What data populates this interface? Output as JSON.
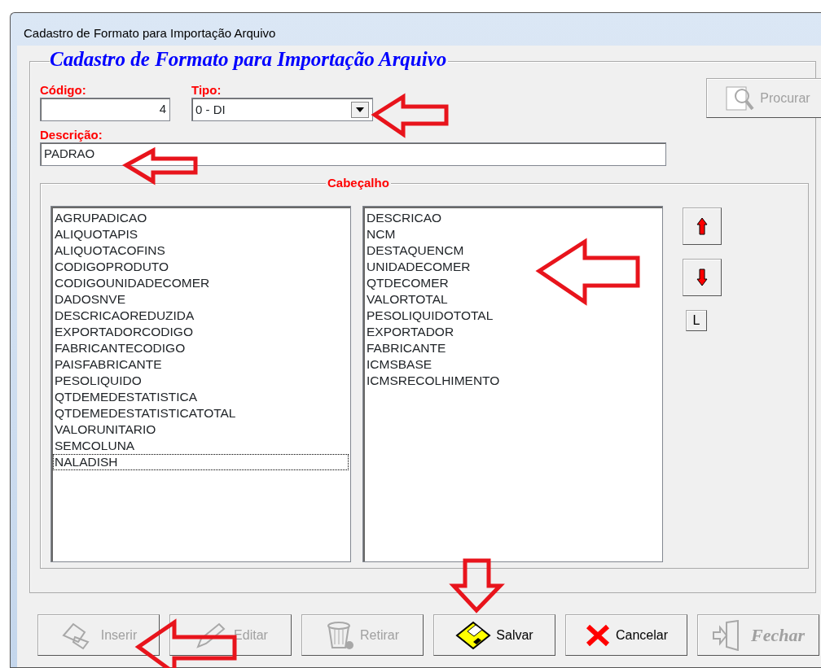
{
  "window": {
    "title": "Cadastro de Formato para Importação Arquivo"
  },
  "form": {
    "heading": "Cadastro de Formato para Importação Arquivo",
    "codigo": {
      "label": "Código:",
      "value": "4"
    },
    "tipo": {
      "label": "Tipo:",
      "value": "0 - DI"
    },
    "descricao": {
      "label": "Descrição:",
      "value": "PADRAO"
    },
    "search_button": {
      "label": "Procurar",
      "kind": "search",
      "disabled": true
    }
  },
  "cabecalho": {
    "title": "Cabeçalho",
    "available": [
      {
        "text": "AGRUPADICAO",
        "selected": false
      },
      {
        "text": "ALIQUOTAPIS",
        "selected": false
      },
      {
        "text": "ALIQUOTACOFINS",
        "selected": false
      },
      {
        "text": "CODIGOPRODUTO",
        "selected": false
      },
      {
        "text": "CODIGOUNIDADECOMER",
        "selected": false
      },
      {
        "text": "DADOSNVE",
        "selected": false
      },
      {
        "text": "DESCRICAOREDUZIDA",
        "selected": false
      },
      {
        "text": "EXPORTADORCODIGO",
        "selected": false
      },
      {
        "text": "FABRICANTECODIGO",
        "selected": false
      },
      {
        "text": "PAISFABRICANTE",
        "selected": false
      },
      {
        "text": "PESOLIQUIDO",
        "selected": false
      },
      {
        "text": "QTDEMEDESTATISTICA",
        "selected": false
      },
      {
        "text": "QTDEMEDESTATISTICATOTAL",
        "selected": false
      },
      {
        "text": "VALORUNITARIO",
        "selected": false
      },
      {
        "text": "SEMCOLUNA",
        "selected": false
      },
      {
        "text": "NALADISH",
        "selected": true
      }
    ],
    "chosen": [
      {
        "text": "DESCRICAO",
        "selected": false
      },
      {
        "text": "NCM",
        "selected": false
      },
      {
        "text": "DESTAQUENCM",
        "selected": false
      },
      {
        "text": "UNIDADECOMER",
        "selected": false
      },
      {
        "text": "QTDECOMER",
        "selected": false
      },
      {
        "text": "VALORTOTAL",
        "selected": false
      },
      {
        "text": "PESOLIQUIDOTOTAL",
        "selected": false
      },
      {
        "text": "EXPORTADOR",
        "selected": false
      },
      {
        "text": "FABRICANTE",
        "selected": false
      },
      {
        "text": "ICMSBASE",
        "selected": false
      },
      {
        "text": "ICMSRECOLHIMENTO",
        "selected": false
      }
    ],
    "side_buttons": [
      {
        "kind": "up"
      },
      {
        "kind": "down"
      },
      {
        "kind": "text",
        "label": "L"
      }
    ]
  },
  "buttons": [
    {
      "label": "Inserir",
      "kind": "insert",
      "disabled": true
    },
    {
      "label": "Editar",
      "kind": "edit",
      "disabled": true
    },
    {
      "label": "Retirar",
      "kind": "remove",
      "disabled": true
    },
    {
      "label": "Salvar",
      "kind": "save",
      "disabled": false
    },
    {
      "label": "Cancelar",
      "kind": "cancel",
      "disabled": false
    },
    {
      "label": "Fechar",
      "kind": "close",
      "disabled": true
    }
  ]
}
